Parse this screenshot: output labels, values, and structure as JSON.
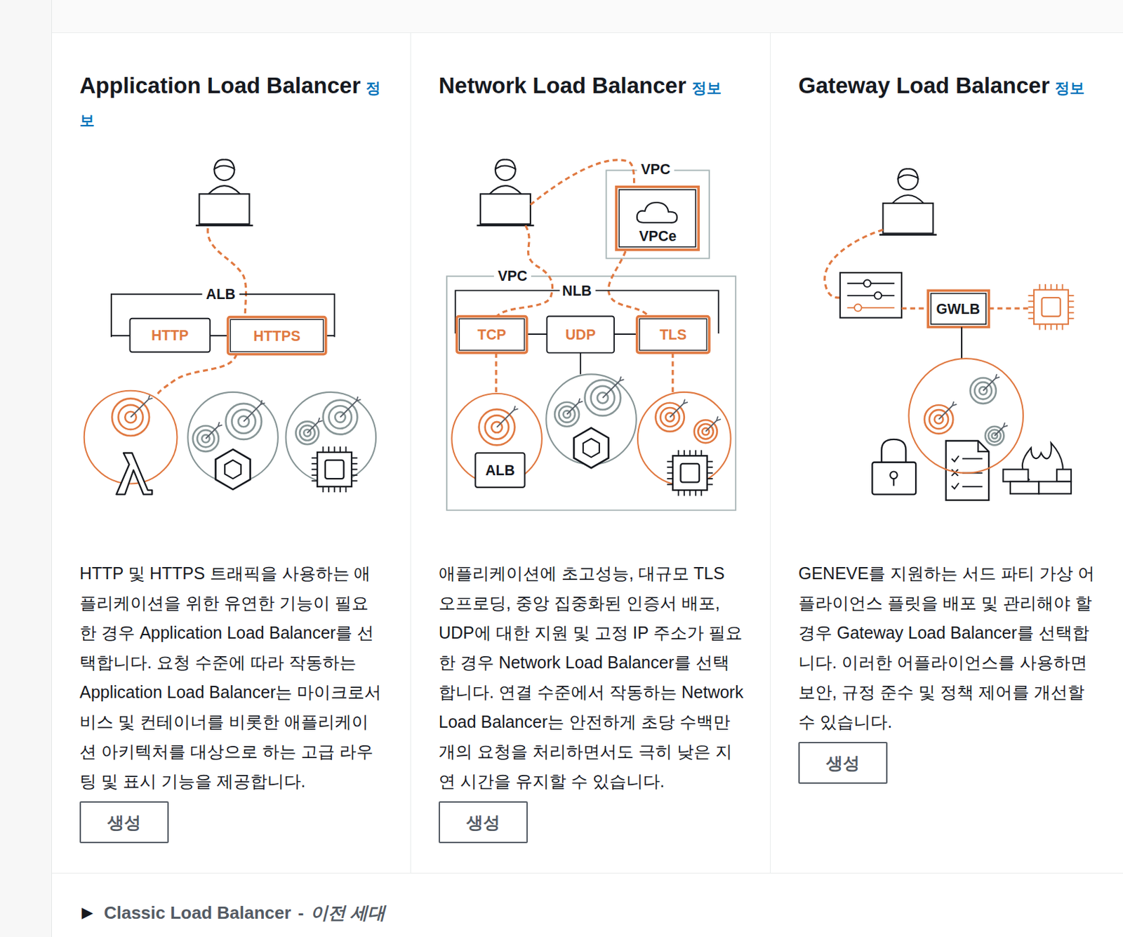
{
  "load_balancers": [
    {
      "title": "Application Load Balancer",
      "info": "정보",
      "description": "HTTP 및 HTTPS 트래픽을 사용하는 애플리케이션을 위한 유연한 기능이 필요한 경우 Application Load Balancer를 선택합니다. 요청 수준에 따라 작동하는 Application Load Balancer는 마이크로서비스 및 컨테이너를 비롯한 애플리케이션 아키텍처를 대상으로 하는 고급 라우팅 및 표시 기능을 제공합니다.",
      "button": "생성",
      "diagram": {
        "kind": "alb",
        "bracket_label": "ALB",
        "listeners": [
          {
            "label": "HTTP",
            "selected": false
          },
          {
            "label": "HTTPS",
            "selected": true
          }
        ],
        "targets": [
          {
            "selected": true
          },
          {
            "selected": false
          },
          {
            "selected": false
          }
        ]
      }
    },
    {
      "title": "Network Load Balancer",
      "info": "정보",
      "description": "애플리케이션에 초고성능, 대규모 TLS 오프로딩, 중앙 집중화된 인증서 배포, UDP에 대한 지원 및 고정 IP 주소가 필요한 경우 Network Load Balancer를 선택합니다. 연결 수준에서 작동하는 Network Load Balancer는 안전하게 초당 수백만 개의 요청을 처리하면서도 극히 낮은 지연 시간을 유지할 수 있습니다.",
      "button": "생성",
      "diagram": {
        "kind": "nlb",
        "bracket_label": "NLB",
        "vpc_label": "VPC",
        "endpoint_vpc_label": "VPC",
        "endpoint_label": "VPCe",
        "target_label": "ALB",
        "listeners": [
          {
            "label": "TCP",
            "selected": true
          },
          {
            "label": "UDP",
            "selected": false
          },
          {
            "label": "TLS",
            "selected": true
          }
        ],
        "targets": [
          {
            "selected": true
          },
          {
            "selected": false
          },
          {
            "selected": true
          }
        ]
      }
    },
    {
      "title": "Gateway Load Balancer",
      "info": "정보",
      "description": "GENEVE를 지원하는 서드 파티 가상 어플라이언스 플릿을 배포 및 관리해야 할 경우 Gateway Load Balancer를 선택합니다. 이러한 어플라이언스를 사용하면 보안, 규정 준수 및 정책 제어를 개선할 수 있습니다.",
      "button": "생성",
      "diagram": {
        "kind": "gwlb",
        "gateway_label": "GWLB",
        "listeners": [],
        "targets": [
          {
            "selected": true
          },
          {
            "selected": false
          },
          {
            "selected": false
          }
        ]
      }
    }
  ],
  "classic": {
    "toggle": "▶",
    "name": "Classic Load Balancer",
    "separator": "-",
    "note": "이전 세대",
    "expanded": false
  }
}
